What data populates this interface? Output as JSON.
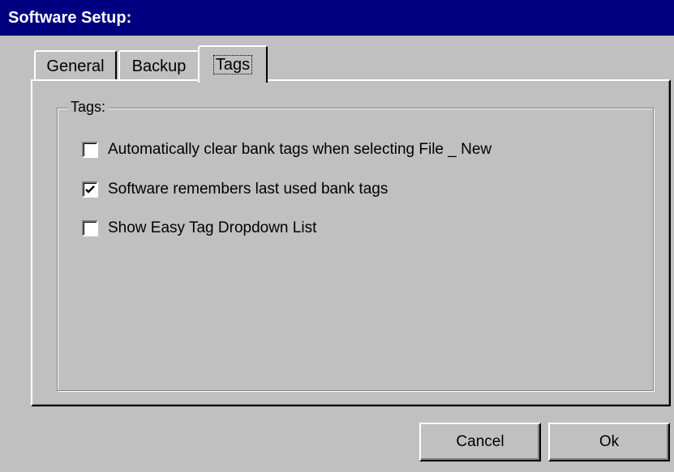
{
  "window": {
    "title": "Software Setup:"
  },
  "tabs": [
    {
      "label": "General",
      "active": false
    },
    {
      "label": "Backup",
      "active": false
    },
    {
      "label": "Tags",
      "active": true
    }
  ],
  "tags_group": {
    "legend": "Tags:",
    "options": [
      {
        "label": "Automatically clear bank tags when selecting File _ New",
        "checked": false
      },
      {
        "label": "Software remembers last used bank tags",
        "checked": true
      },
      {
        "label": "Show Easy Tag Dropdown List",
        "checked": false
      }
    ]
  },
  "buttons": {
    "cancel": "Cancel",
    "ok": "Ok"
  },
  "colors": {
    "titlebar": "#000080",
    "face": "#c0c0c0"
  }
}
